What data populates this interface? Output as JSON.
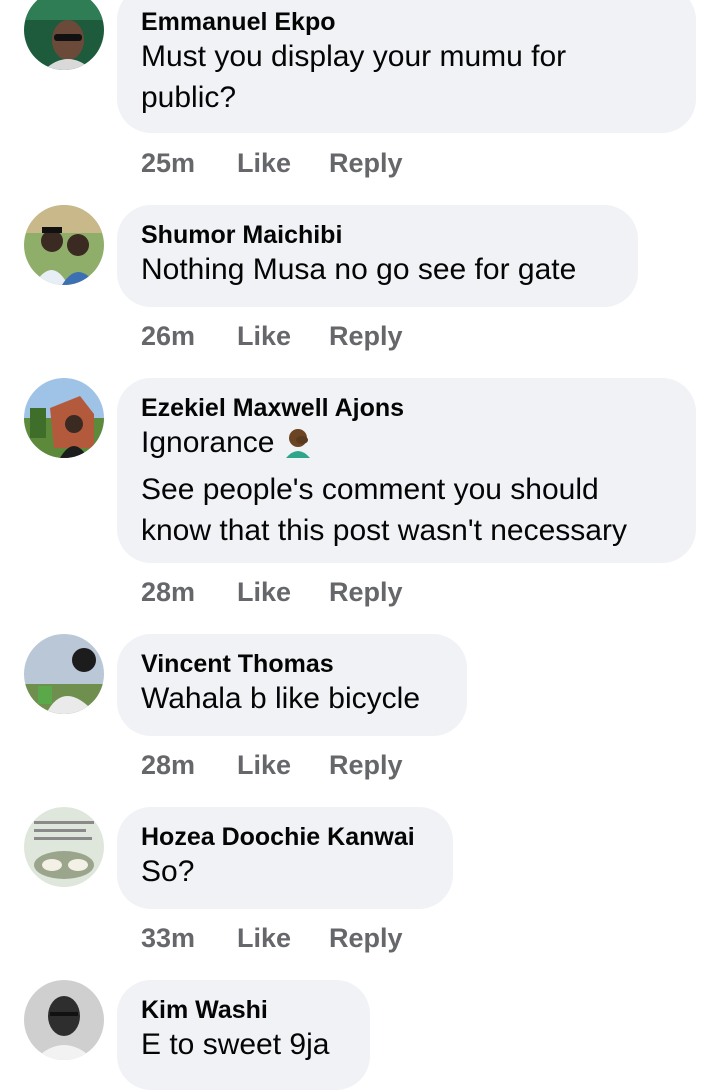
{
  "comments": [
    {
      "name": "Emmanuel Ekpo",
      "lines": [
        "Must you display your mumu for",
        "public?"
      ],
      "time": "25m",
      "like": "Like",
      "reply": "Reply"
    },
    {
      "name": "Shumor Maichibi",
      "lines": [
        "Nothing Musa no go see for gate"
      ],
      "time": "26m",
      "like": "Like",
      "reply": "Reply"
    },
    {
      "name": "Ezekiel Maxwell Ajons",
      "lines": [
        "Ignorance",
        "See people's comment you should",
        "know that this post wasn't necessary"
      ],
      "emoji": "facepalm-emoji",
      "time": "28m",
      "like": "Like",
      "reply": "Reply"
    },
    {
      "name": "Vincent Thomas",
      "lines": [
        "Wahala b like bicycle"
      ],
      "time": "28m",
      "like": "Like",
      "reply": "Reply"
    },
    {
      "name": "Hozea Doochie Kanwai",
      "lines": [
        "So?"
      ],
      "time": "33m",
      "like": "Like",
      "reply": "Reply"
    },
    {
      "name": "Kim Washi",
      "lines": [
        "E to sweet 9ja"
      ]
    }
  ],
  "colors": {
    "bubble": "#f0f2f5",
    "text": "#050505",
    "meta": "#65676b"
  }
}
